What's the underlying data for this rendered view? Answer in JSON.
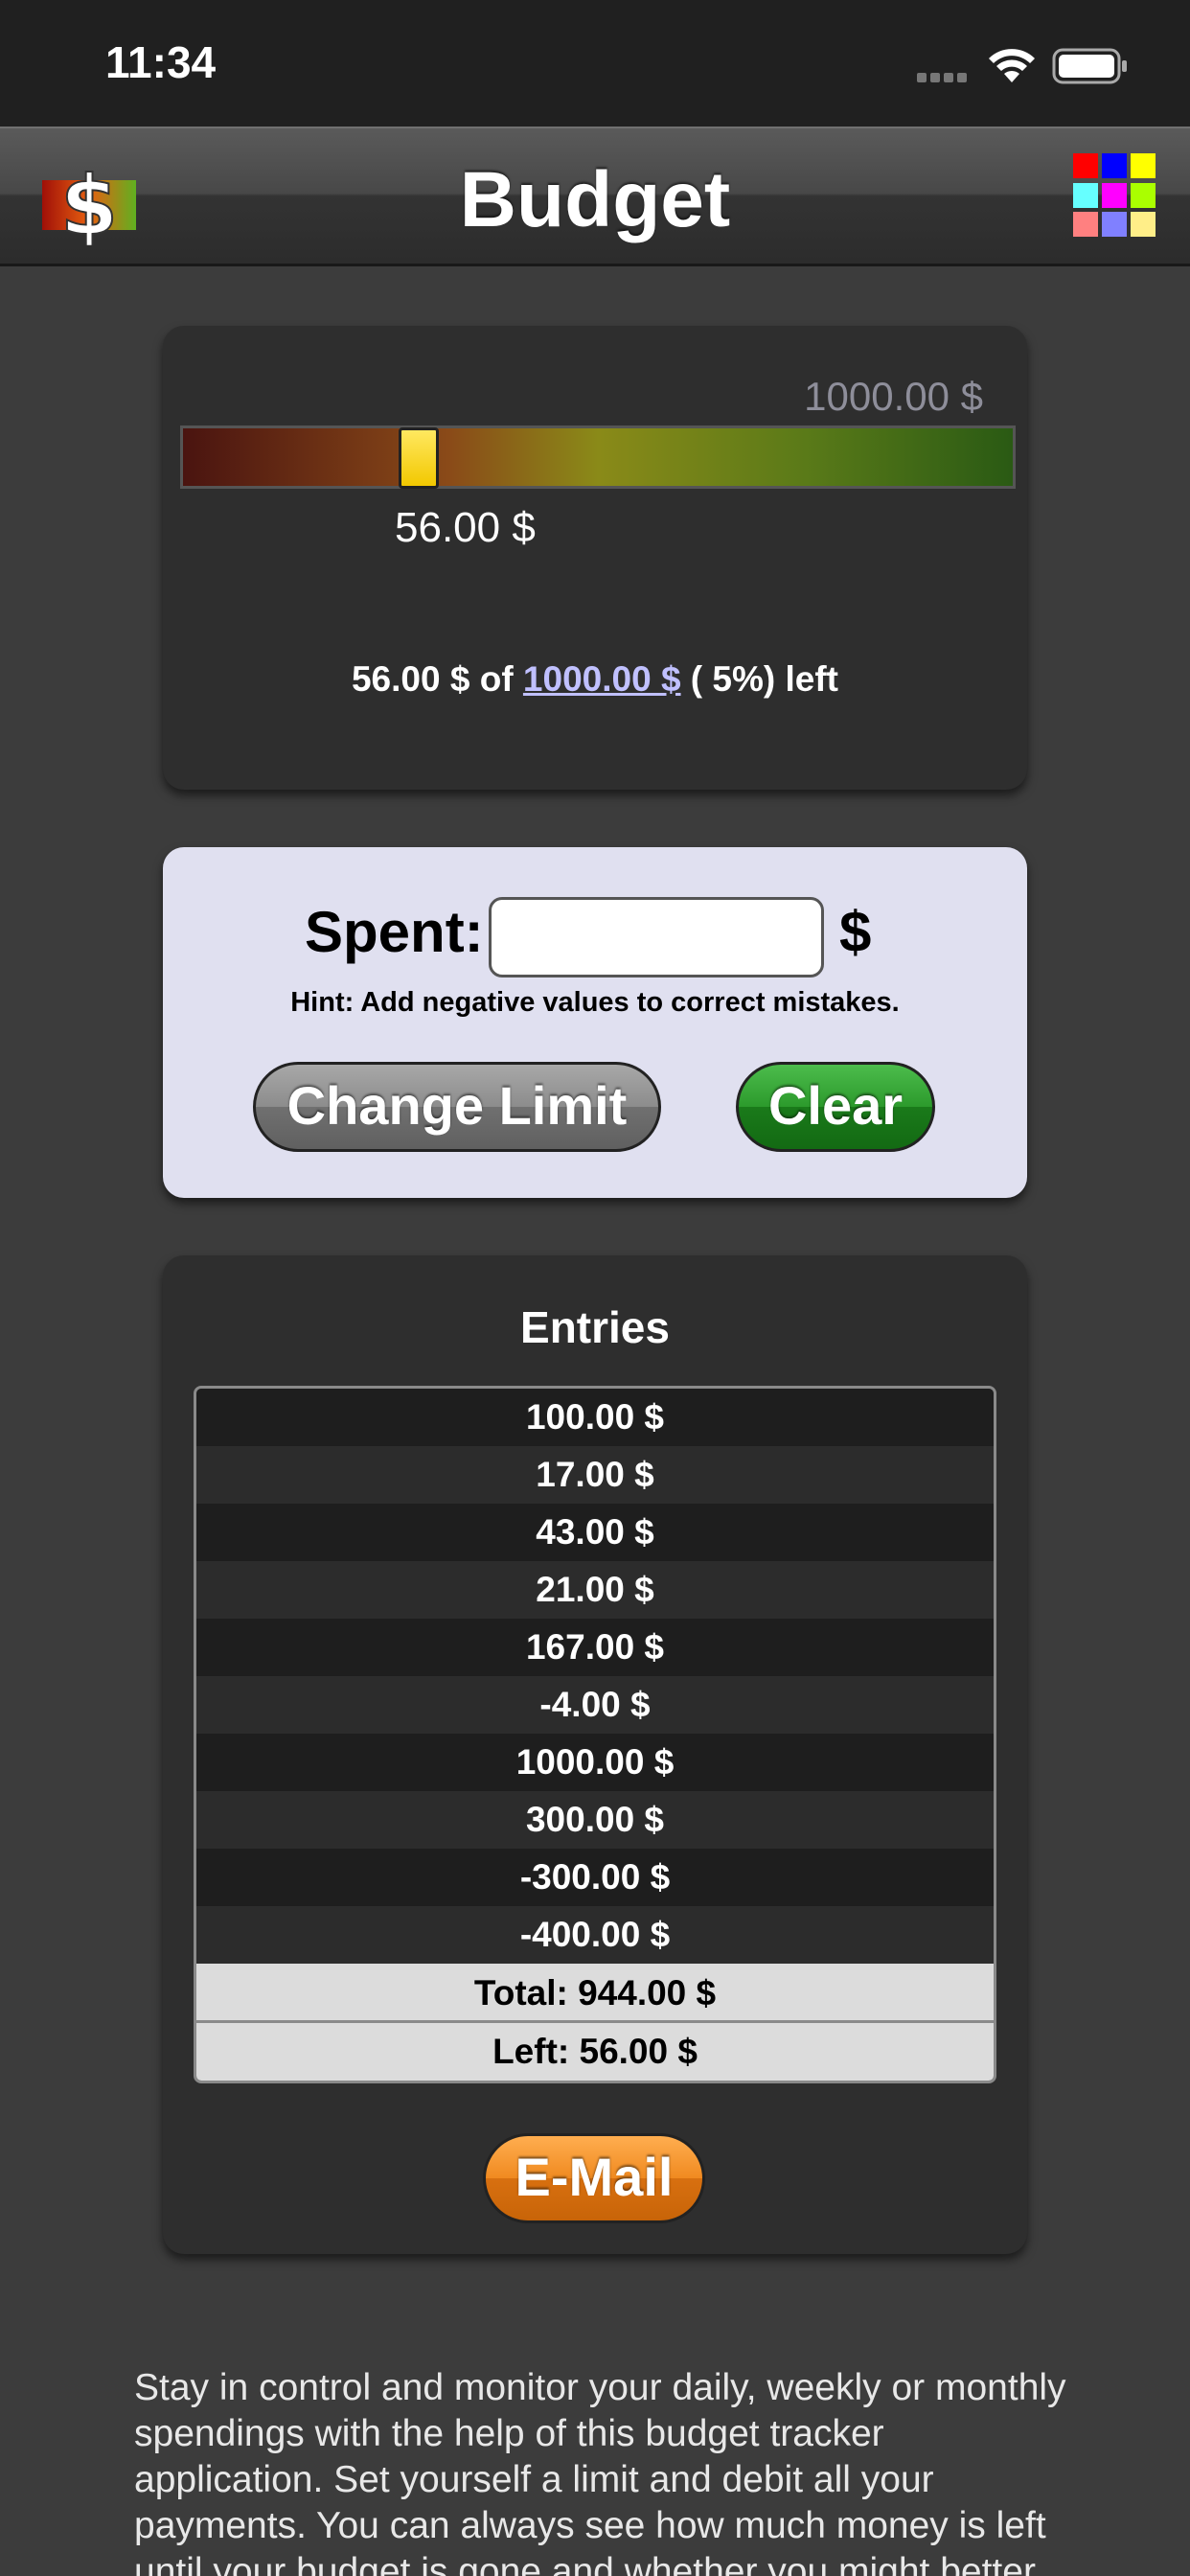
{
  "status": {
    "time": "11:34"
  },
  "nav": {
    "title": "Budget"
  },
  "meter": {
    "limit_label": "1000.00 $",
    "spent_label": "56.00 $",
    "fill_fraction": 0.056,
    "summary_prefix": "56.00 $ of ",
    "summary_limit": "1000.00 $",
    "summary_suffix": " ( 5%) left"
  },
  "input": {
    "spent_title": "Spent:",
    "value": "",
    "currency": "$",
    "hint": "Hint: Add negative values to correct mistakes.",
    "change_limit_label": "Change Limit",
    "clear_label": "Clear"
  },
  "entries": {
    "title": "Entries",
    "items": [
      "100.00 $",
      "17.00 $",
      "43.00 $",
      "21.00 $",
      "167.00 $",
      "-4.00 $",
      "1000.00 $",
      "300.00 $",
      "-300.00 $",
      "-400.00 $"
    ],
    "total": "Total: 944.00 $",
    "left": "Left: 56.00 $",
    "email_label": "E-Mail"
  },
  "description": "Stay in control and monitor your daily, weekly or monthly spendings with the help of this budget tracker application. Set yourself a limit and debit all your payments. You can always see how much money is left until your budget is gone and whether you might better",
  "colors": {
    "grid_icon": [
      "#ff0000",
      "#0000ff",
      "#ffff00",
      "#66ffff",
      "#ff00ff",
      "#aaff00",
      "#ff8080",
      "#8080ff",
      "#ffee88"
    ]
  }
}
